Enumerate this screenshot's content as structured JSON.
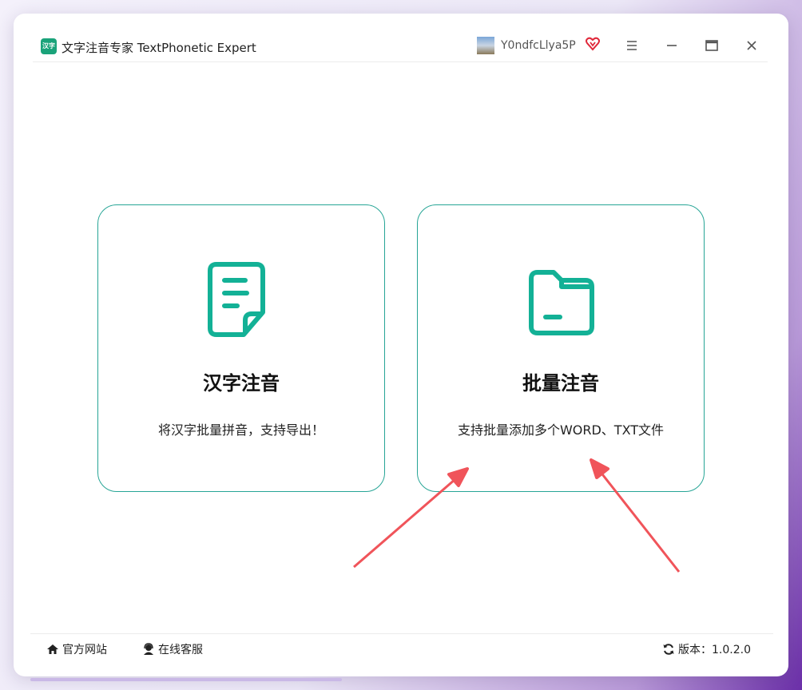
{
  "app": {
    "title": "文字注音专家 TextPhonetic Expert",
    "icon_text": "汉字",
    "user": "Y0ndfcLlya5P"
  },
  "icons": {
    "app": "app-logo-icon",
    "avatar": "user-avatar",
    "vip": "vip-heart-icon",
    "menu": "menu-icon",
    "minimize": "minimize-icon",
    "maximize": "maximize-icon",
    "close": "close-icon",
    "card1": "document-icon",
    "card2": "folder-icon",
    "home": "home-icon",
    "support": "headset-icon",
    "refresh": "refresh-icon"
  },
  "cards": [
    {
      "title": "汉字注音",
      "desc": "将汉字批量拼音，支持导出！"
    },
    {
      "title": "批量注音",
      "desc": "支持批量添加多个WORD、TXT文件"
    }
  ],
  "footer": {
    "official_site": "官方网站",
    "online_service": "在线客服",
    "version": "版本：1.0.2.0"
  },
  "colors": {
    "accent": "#13b196",
    "card_border": "#27a596",
    "annotation_arrow": "#f0545a"
  }
}
